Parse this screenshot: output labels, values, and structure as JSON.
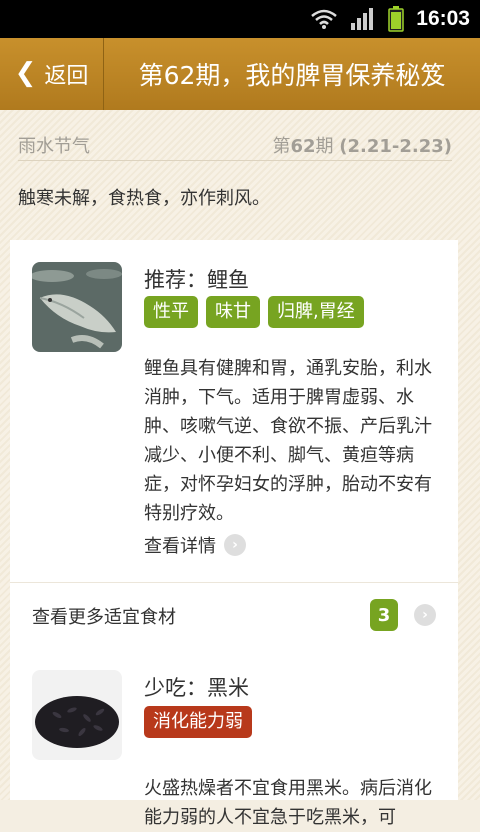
{
  "status_bar": {
    "time": "16:03"
  },
  "header": {
    "back_label": "返回",
    "title": "第62期，我的脾胃保养秘笈"
  },
  "info": {
    "solar_term": "雨水节气",
    "issue_prefix": "第",
    "issue_number": "62",
    "issue_suffix": "期",
    "date_range": "(2.21-2.23)",
    "proverb": "触寒未解，食热食，亦作刺风。"
  },
  "recommended": {
    "name": "推荐：鲤鱼",
    "tags": [
      "性平",
      "味甘",
      "归脾,胃经"
    ],
    "description": "鲤鱼具有健脾和胃，通乳安胎，利水消肿，下气。适用于脾胃虚弱、水肿、咳嗽气逆、食欲不振、产后乳汁减少、小便不利、脚气、黄疸等病症，对怀孕妇女的浮肿，胎动不安有特别疗效。",
    "detail_label": "查看详情",
    "image_icon": "carp-fish-photo"
  },
  "more_foods": {
    "label": "查看更多适宜食材",
    "count": "3"
  },
  "avoid": {
    "name": "少吃：黑米",
    "tags": [
      "消化能力弱"
    ],
    "description": "火盛热燥者不宜食用黑米。病后消化能力弱的人不宜急于吃黑米，可",
    "image_icon": "black-rice-photo"
  },
  "colors": {
    "header": "#bd8524",
    "tag_green": "#77a421",
    "tag_red": "#b8391b"
  }
}
